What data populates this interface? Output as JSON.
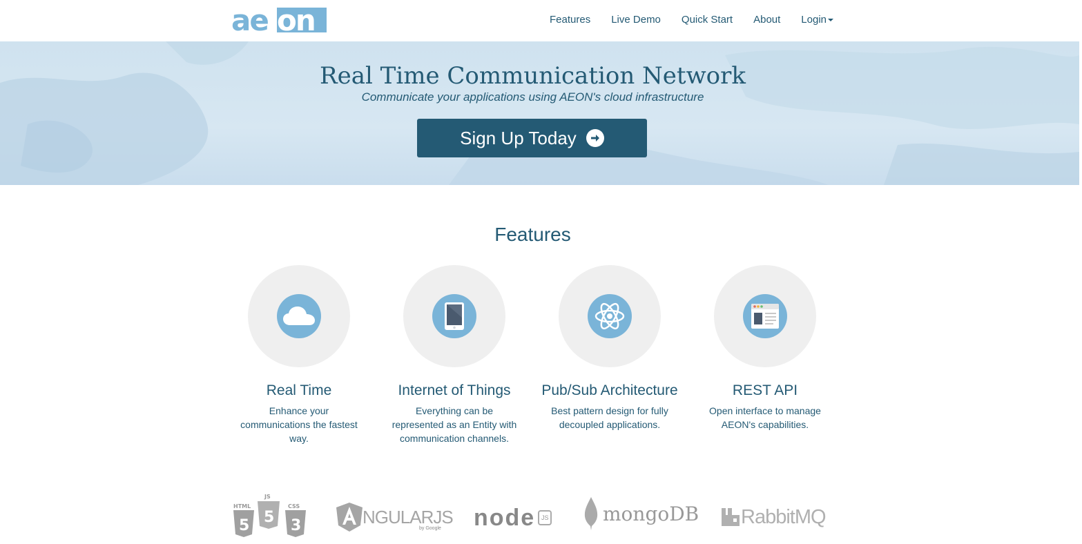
{
  "brand": {
    "logo_text": "aeon"
  },
  "nav": {
    "items": [
      "Features",
      "Live Demo",
      "Quick Start",
      "About"
    ],
    "login": "Login"
  },
  "hero": {
    "title": "Real Time Communication Network",
    "subtitle": "Communicate your applications using AEON's cloud infrastructure",
    "cta": "Sign Up Today"
  },
  "features": {
    "title": "Features",
    "items": [
      {
        "title": "Real Time",
        "description": "Enhance your communications the fastest way.",
        "icon": "cloud-icon"
      },
      {
        "title": "Internet of Things",
        "description": "Everything can be represented as an Entity with communication channels.",
        "icon": "tablet-icon"
      },
      {
        "title": "Pub/Sub Architecture",
        "description": "Best pattern design for fully decoupled applications.",
        "icon": "atom-icon"
      },
      {
        "title": "REST API",
        "description": "Open interface to manage AEON's capabilities.",
        "icon": "browser-window-icon"
      }
    ]
  },
  "tech": {
    "html5": [
      "HTML",
      "JS",
      "CSS"
    ],
    "angular": "NGULARJS",
    "angular_by": "by Google",
    "node": "node",
    "node_js": "JS",
    "mongo": "mongoDB",
    "rabbit": "RabbitMQ"
  },
  "colors": {
    "primary": "#245a74",
    "accent": "#7ab4d8",
    "circle_bg": "#efefef"
  }
}
